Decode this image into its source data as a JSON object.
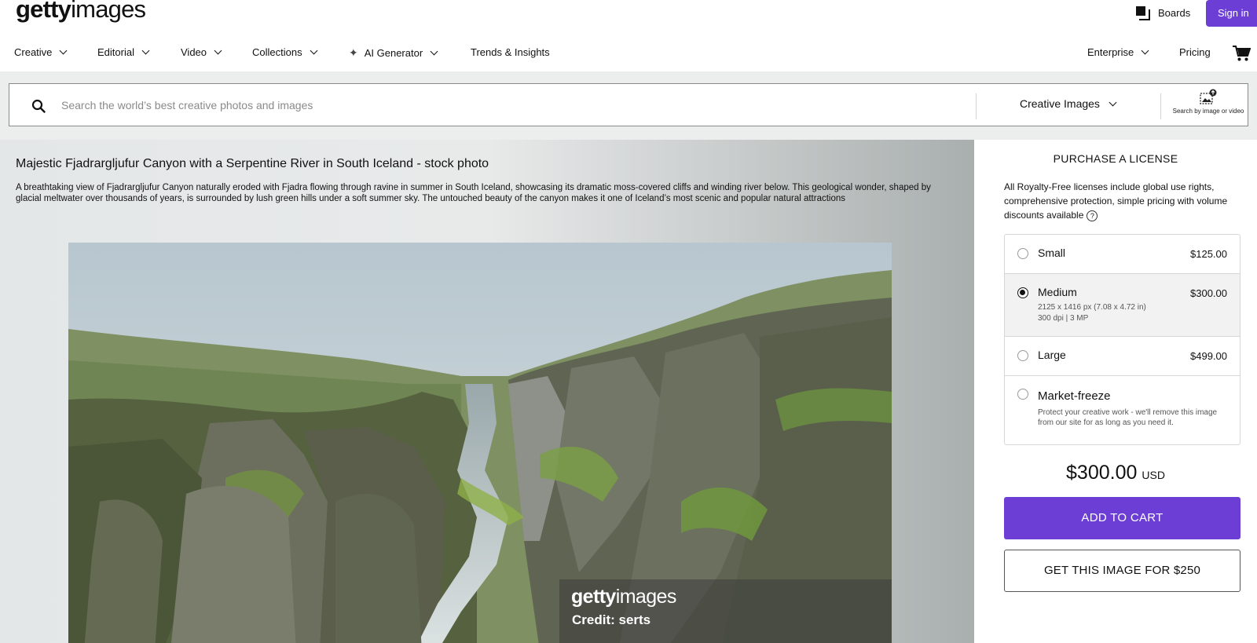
{
  "brand": {
    "logo_bold": "getty",
    "logo_light": "images"
  },
  "header": {
    "boards_label": "Boards",
    "signin_label": "Sign in"
  },
  "nav": {
    "creative": "Creative",
    "editorial": "Editorial",
    "video": "Video",
    "collections": "Collections",
    "ai_generator": "AI Generator",
    "trends": "Trends & Insights",
    "enterprise": "Enterprise",
    "pricing": "Pricing"
  },
  "search": {
    "placeholder": "Search the world’s best creative photos and images",
    "value": "",
    "type_selected": "Creative Images",
    "image_search_label": "Search by image or video"
  },
  "asset": {
    "title": "Majestic Fjadrargljufur Canyon with a Serpentine River in South Iceland - stock photo",
    "description": "A breathtaking view of Fjadrargljufur Canyon naturally eroded with Fjadra flowing through ravine in summer in South Iceland, showcasing its dramatic moss-covered cliffs and winding river below. This geological wonder, shaped by glacial meltwater over thousands of years, is surrounded by lush green hills under a soft summer sky. The untouched beauty of the canyon makes it one of Iceland’s most scenic and popular natural attractions",
    "watermark_bold": "getty",
    "watermark_light": "images",
    "credit": "Credit: serts"
  },
  "license": {
    "heading": "PURCHASE A LICENSE",
    "intro": "All Royalty-Free licenses include global use rights, comprehensive protection, simple pricing with volume discounts available",
    "help_glyph": "?",
    "options": [
      {
        "name": "Small",
        "price": "$125.00",
        "selected": false
      },
      {
        "name": "Medium",
        "price": "$300.00",
        "detail_1": "2125 x 1416 px (7.08 x 4.72 in)",
        "detail_2": "300 dpi | 3 MP",
        "selected": true
      },
      {
        "name": "Large",
        "price": "$499.00",
        "selected": false
      },
      {
        "name": "Market-freeze",
        "detail": "Protect your creative work - we'll remove this image from our site for as long as you need it.",
        "selected": false
      }
    ],
    "total_amount": "$300.00",
    "total_currency": "USD",
    "add_to_cart_label": "ADD TO CART",
    "get_image_label": "GET THIS IMAGE FOR $250"
  },
  "colors": {
    "accent": "#6c3ed6",
    "text": "#111111",
    "border": "#d6d6d6"
  }
}
